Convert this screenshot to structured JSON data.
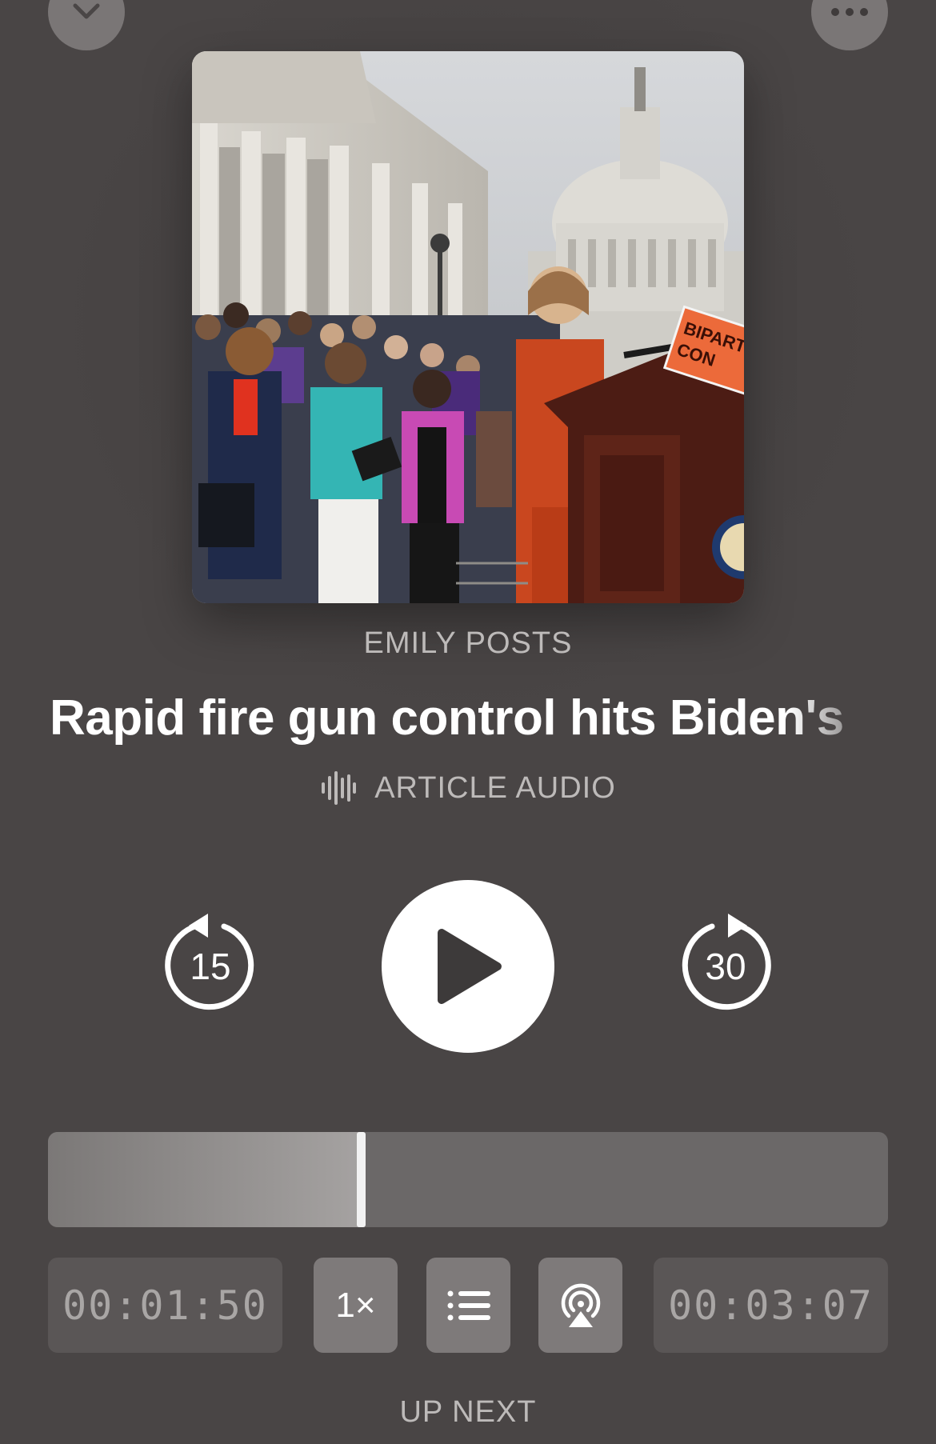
{
  "header": {
    "collapse_icon": "chevron-down-icon",
    "more_icon": "ellipsis-icon"
  },
  "artwork": {
    "banner_text": "BIPART CON"
  },
  "episode": {
    "publisher": "EMILY POSTS",
    "title": "Rapid fire gun control hits Biden's",
    "source_label": "ARTICLE AUDIO",
    "source_icon": "waveform-icon"
  },
  "controls": {
    "skip_back_label": "15",
    "skip_forward_label": "30",
    "play_icon": "play-icon"
  },
  "progress": {
    "fraction": 0.37,
    "elapsed": "00:01:50",
    "remaining": "00:03:07"
  },
  "toolbar": {
    "speed_label": "1×",
    "queue_icon": "list-icon",
    "airplay_icon": "airplay-audio-icon"
  },
  "footer": {
    "up_next_label": "UP NEXT"
  }
}
